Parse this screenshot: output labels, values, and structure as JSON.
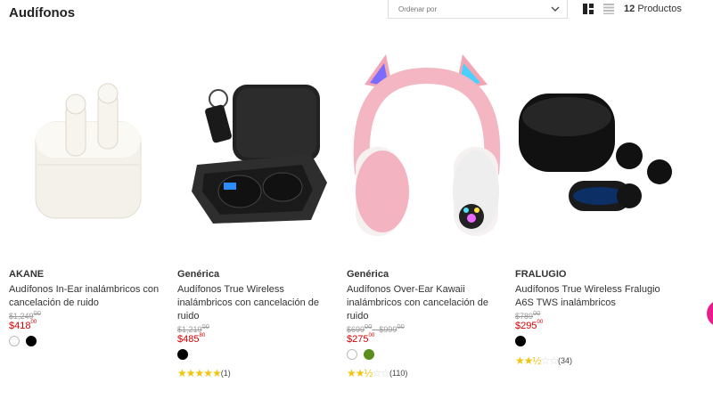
{
  "header": {
    "title": "Audífonos",
    "sort_placeholder": "Ordenar por",
    "product_count": "12",
    "product_count_label": "Productos"
  },
  "products": [
    {
      "brand": "AKANE",
      "name": "Audífonos In-Ear inalámbricos con cancelación de ruido",
      "old_price": "$1,249",
      "old_price_cents": "00",
      "price": "$418",
      "price_cents": "00",
      "swatches": [
        "#ffffff",
        "#000000"
      ]
    },
    {
      "brand": "Genérica",
      "name": "Audífonos True Wireless inalámbricos con cancelación de ruido",
      "old_price": "$1,219",
      "old_price_cents": "00",
      "price": "$485",
      "price_cents": "80",
      "swatches": [
        "#000000"
      ],
      "rating_stars": 5,
      "rating_count": "(1)"
    },
    {
      "brand": "Genérica",
      "name": "Audífonos Over-Ear Kawaii inalámbricos con cancelación de ruido",
      "old_price": "$699",
      "old_price_cents": "00",
      "old_price_sep": " - ",
      "old_price_max": "$999",
      "old_price_max_cents": "00",
      "price": "$275",
      "price_cents": "00",
      "swatches": [
        "#ffffff",
        "#5a8f1e"
      ],
      "rating_stars": 2.5,
      "rating_count": "(110)"
    },
    {
      "brand": "FRALUGIO",
      "name": "Audífonos True Wireless Fralugio A6S TWS inalámbricos",
      "old_price": "$789",
      "old_price_cents": "00",
      "price": "$295",
      "price_cents": "00",
      "swatches": [
        "#000000"
      ],
      "rating_stars": 2.5,
      "rating_count": "(34)"
    }
  ],
  "colors": {
    "price": "#d50000",
    "star": "#f1c40f",
    "fab": "#e91e8c"
  }
}
